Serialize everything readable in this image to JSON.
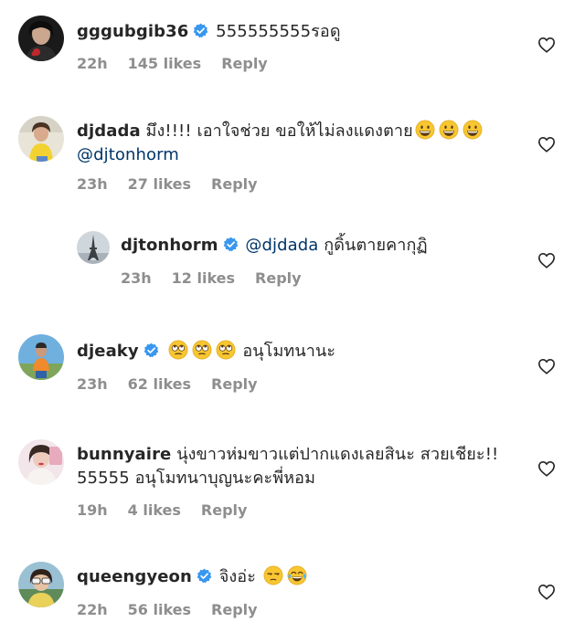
{
  "comments": [
    {
      "username": "gggubgib36",
      "verified": true,
      "text": "555555555รอดู",
      "time": "22h",
      "likes": "145 likes",
      "reply": "Reply"
    },
    {
      "username": "djdada",
      "verified": false,
      "text": "มึง!!!! เอาใจช่วย ขอให้ไม่ลงแดงตาย",
      "emojis": [
        "grinning-face",
        "grinning-face",
        "grinning-face"
      ],
      "mention": "@djtonhorm",
      "time": "23h",
      "likes": "27 likes",
      "reply": "Reply"
    },
    {
      "username": "djtonhorm",
      "verified": true,
      "mention": "@djdada",
      "text": "กูดิ้นตายคากุฏิ",
      "time": "23h",
      "likes": "12 likes",
      "reply": "Reply"
    },
    {
      "username": "djeaky",
      "verified": true,
      "emojis": [
        "eye-roll-face",
        "eye-roll-face",
        "eye-roll-face"
      ],
      "text": "อนุโมทนานะ",
      "time": "23h",
      "likes": "62 likes",
      "reply": "Reply"
    },
    {
      "username": "bunnyaire",
      "verified": false,
      "text": "นุ่งขาวห่มขาวแต่ปากแดงเลยสินะ สวยเชียะ!!",
      "text2": "55555 อนุโมทนาบุญนะคะพี่หอม",
      "time": "19h",
      "likes": "4 likes",
      "reply": "Reply"
    },
    {
      "username": "queengyeon",
      "verified": true,
      "text": "จิงอ่ะ",
      "emojis": [
        "unamused-face",
        "tears-of-joy-face"
      ],
      "time": "22h",
      "likes": "56 likes",
      "reply": "Reply"
    }
  ],
  "colors": {
    "text": "#262626",
    "meta": "#8e8e8e",
    "mention": "#003569",
    "verified": "#3897f0"
  }
}
